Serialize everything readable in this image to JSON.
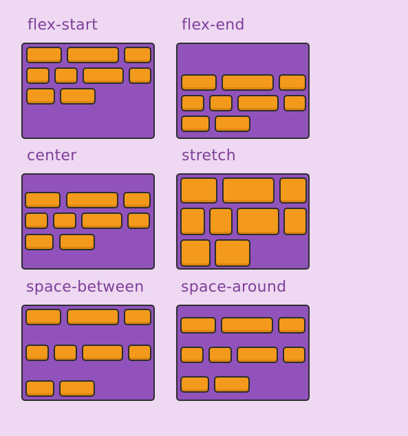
{
  "colors": {
    "background": "#eed8f2",
    "container": "#9153bb",
    "item": "#f39a1c",
    "title": "#7e3f98",
    "outline": "#2d2d2d"
  },
  "panels": [
    {
      "id": "flex-start",
      "title": "flex-start"
    },
    {
      "id": "flex-end",
      "title": "flex-end"
    },
    {
      "id": "center",
      "title": "center"
    },
    {
      "id": "stretch",
      "title": "stretch"
    },
    {
      "id": "space-between",
      "title": "space-between"
    },
    {
      "id": "space-around",
      "title": "space-around"
    }
  ]
}
